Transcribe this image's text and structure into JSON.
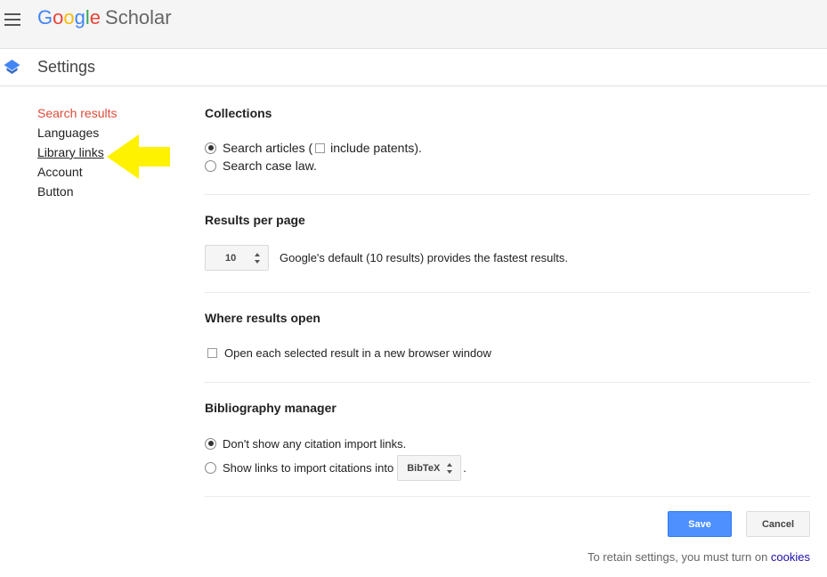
{
  "header": {
    "logo": {
      "letters": [
        "G",
        "o",
        "o",
        "g",
        "l",
        "e"
      ],
      "product": "Scholar"
    },
    "menu_icon": "hamburger-menu-icon"
  },
  "settings_bar": {
    "title": "Settings",
    "icon": "graduation-cap-icon"
  },
  "sidebar": {
    "items": [
      {
        "label": "Search results",
        "active": true
      },
      {
        "label": "Languages"
      },
      {
        "label": "Library links",
        "underlined": true
      },
      {
        "label": "Account"
      },
      {
        "label": "Button"
      }
    ],
    "annotation_arrow_color": "#fff200"
  },
  "collections": {
    "heading": "Collections",
    "search_articles_label": "Search articles (",
    "include_patents_label": "include patents).",
    "search_case_law_label": "Search case law.",
    "selected": "search_articles",
    "include_patents_checked": false
  },
  "results_per_page": {
    "heading": "Results per page",
    "value": "10",
    "hint": "Google's default (10 results) provides the fastest results."
  },
  "where_results_open": {
    "heading": "Where results open",
    "new_window_label": "Open each selected result in a new browser window",
    "new_window_checked": false
  },
  "bibliography": {
    "heading": "Bibliography manager",
    "dont_show_label": "Don't show any citation import links.",
    "show_links_label": "Show links to import citations into",
    "format_value": "BibTeX",
    "trailing_period": ".",
    "selected": "dont_show"
  },
  "actions": {
    "save_label": "Save",
    "cancel_label": "Cancel"
  },
  "footer": {
    "note": "To retain settings, you must turn on",
    "cookies_link": "cookies"
  },
  "colors": {
    "accent_blue": "#4d90fe",
    "active_red": "#dd4b39",
    "link": "#1a0dab"
  }
}
